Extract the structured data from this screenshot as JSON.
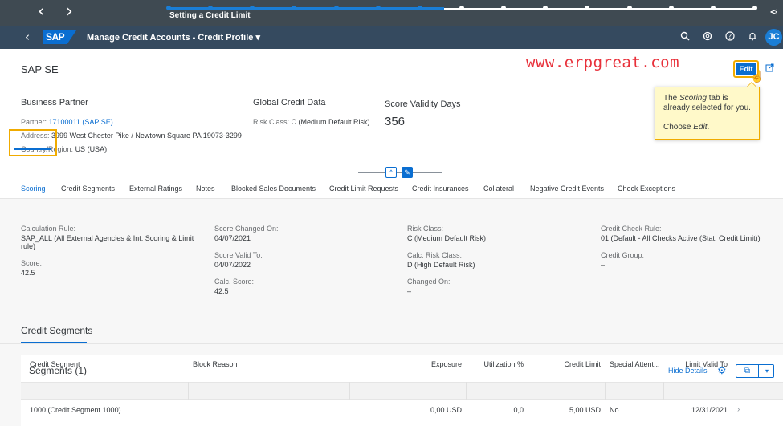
{
  "tour": {
    "title": "Setting a Credit Limit",
    "back_icon": "chevron-left-icon",
    "forward_icon": "chevron-right-icon",
    "progress_fraction": 0.47
  },
  "shell": {
    "logo": "SAP",
    "app_title": "Manage Credit Accounts - Credit Profile ▾",
    "avatar_initials": "JC",
    "icons": [
      "search-icon",
      "notifications-overview-icon",
      "help-icon",
      "bell-icon"
    ]
  },
  "header": {
    "object_title": "SAP SE",
    "watermark": "www.erpgreat.com",
    "edit_label": "Edit",
    "tooltip": {
      "pre": "The ",
      "em": "Scoring",
      "post": " tab is already selected for you.",
      "line2_pre": "Choose ",
      "line2_em": "Edit",
      "line2_post": "."
    },
    "business_partner": {
      "title": "Business Partner",
      "partner_label": "Partner:",
      "partner_value": "17100011 (SAP SE)",
      "address_label": "Address:",
      "address_value": "3999 West Chester Pike / Newtown Square PA 19073-3299",
      "country_label": "Country/Region:",
      "country_value": "US (USA)"
    },
    "global_credit": {
      "title": "Global Credit Data",
      "risk_label": "Risk Class:",
      "risk_value": "C (Medium Default Risk)"
    },
    "validity": {
      "title": "Score Validity Days",
      "value": "356"
    }
  },
  "tabs": [
    "Scoring",
    "Credit Segments",
    "External Ratings",
    "Notes",
    "Blocked Sales Documents",
    "Credit Limit Requests",
    "Credit Insurances",
    "Collateral",
    "Negative Credit Events",
    "Check Exceptions"
  ],
  "scoring": {
    "calc_rule_label": "Calculation Rule:",
    "calc_rule_value_1": "SAP_ALL (All External Agencies & Int. Scoring & Limit",
    "calc_rule_value_2": "rule)",
    "score_label": "Score:",
    "score_value": "42.5",
    "score_changed_label": "Score Changed On:",
    "score_changed_value": "04/07/2021",
    "score_valid_label": "Score Valid To:",
    "score_valid_value": "04/07/2022",
    "calc_score_label": "Calc. Score:",
    "calc_score_value": "42.5",
    "risk_label": "Risk Class:",
    "risk_value": "C (Medium Default Risk)",
    "calc_risk_label": "Calc. Risk Class:",
    "calc_risk_value": "D (High Default Risk)",
    "changed_on_label": "Changed On:",
    "changed_on_value": "–",
    "check_rule_label": "Credit Check Rule:",
    "check_rule_value": "01 (Default - All Checks Active (Stat. Credit Limit))",
    "group_label": "Credit Group:",
    "group_value": "–"
  },
  "credit_segments": {
    "section_title": "Credit Segments",
    "table_title": "Segments (1)",
    "hide_details": "Hide Details",
    "columns": [
      "Credit Segment",
      "Block Reason",
      "Exposure",
      "Utilization %",
      "Credit Limit",
      "Special Attent...",
      "Limit Valid To"
    ],
    "rows": [
      [
        "1000 (Credit Segment 1000)",
        "",
        "0,00  USD",
        "0,0",
        "5,00  USD",
        "No",
        "12/31/2021"
      ]
    ]
  }
}
